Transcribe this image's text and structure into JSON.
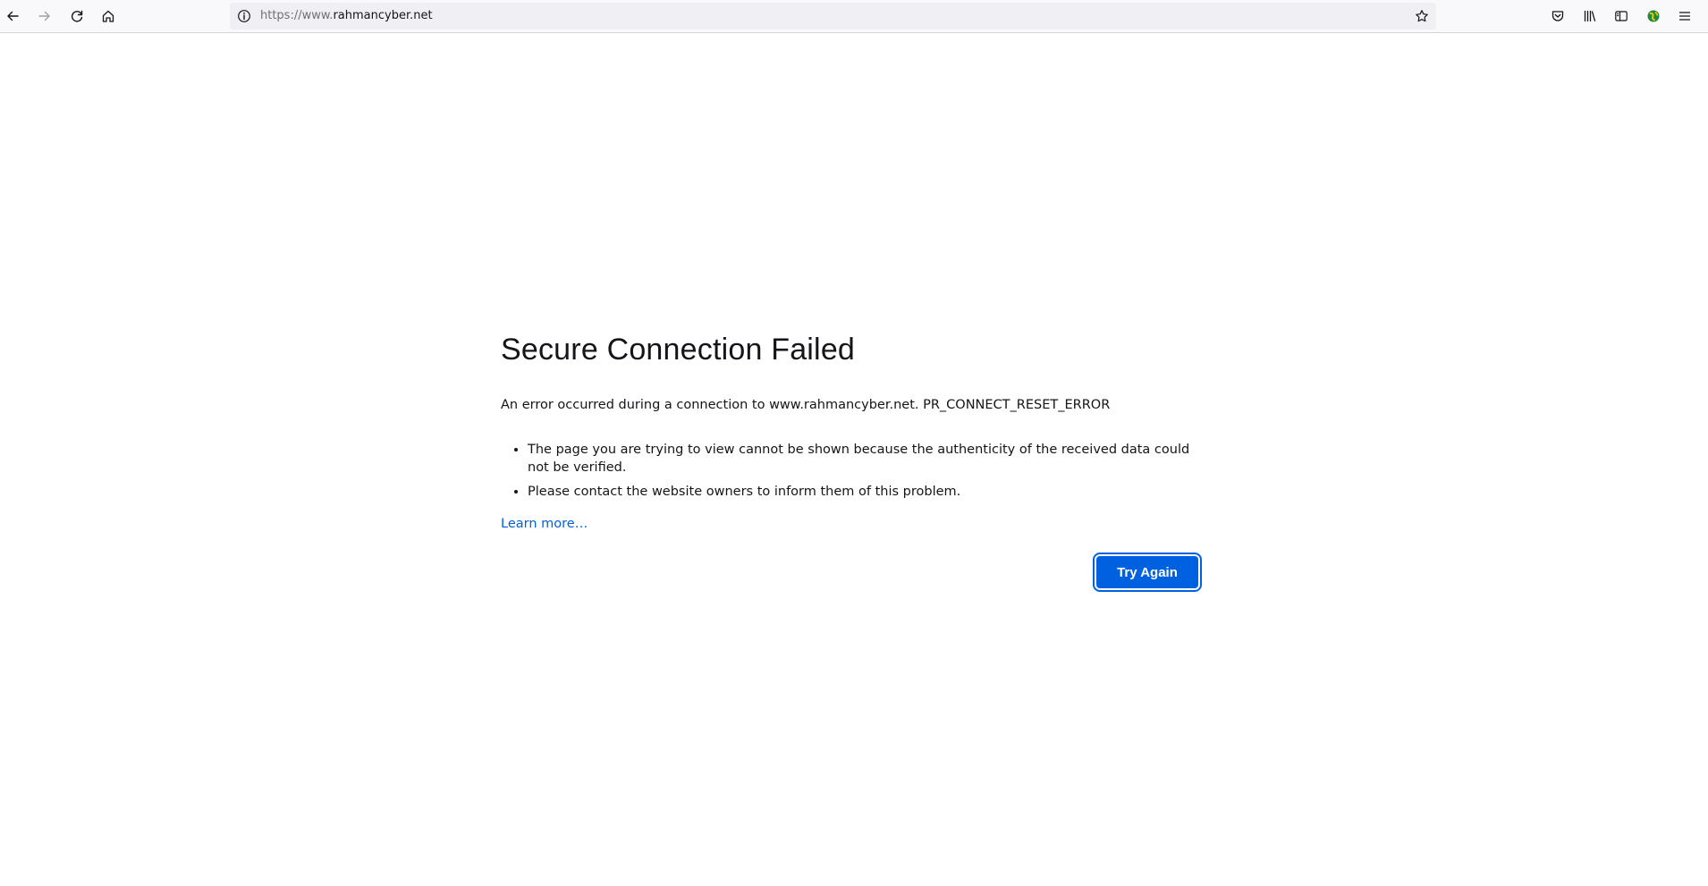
{
  "toolbar": {
    "back_icon": "arrow-left-icon",
    "forward_icon": "arrow-right-icon",
    "reload_icon": "reload-icon",
    "home_icon": "home-icon",
    "url": {
      "scheme": "https://www.",
      "host": "rahmancyber.net",
      "info_icon": "info-icon",
      "bookmark_icon": "star-icon"
    },
    "right_icons": [
      "pocket-icon",
      "library-icon",
      "sidebar-icon",
      "extension-globe-icon",
      "menu-icon"
    ]
  },
  "error_page": {
    "title": "Secure Connection Failed",
    "short_desc": "An error occurred during a connection to www.rahmancyber.net. PR_CONNECT_RESET_ERROR",
    "bullets": [
      "The page you are trying to view cannot be shown because the authenticity of the received data could not be verified.",
      "Please contact the website owners to inform them of this problem."
    ],
    "learn_more": "Learn more…",
    "try_again_label": "Try Again"
  },
  "colors": {
    "accent": "#0061e0",
    "link": "#0060df",
    "toolbar_bg": "#f9f9fb",
    "urlbar_bg": "#f0f0f4"
  }
}
